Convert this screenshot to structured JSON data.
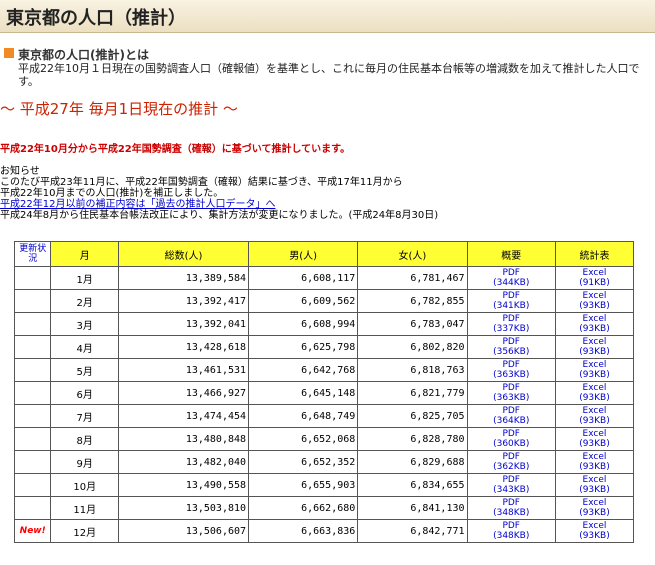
{
  "header": {
    "title": "東京都の人口（推計）"
  },
  "definition": {
    "title": "東京都の人口(推計)とは",
    "body": "平成22年10月１日現在の国勢調査人口（確報値）を基準とし、これに毎月の住民基本台帳等の増減数を加えて推計した人口です。"
  },
  "estimate_heading": "～ 平成27年 毎月1日現在の推計 ～",
  "red_note": "平成22年10月分から平成22年国勢調査（確報）に基づいて推計しています。",
  "notice": {
    "title": "お知らせ",
    "line1": "このたび平成23年11月に、平成22年国勢調査（確報）結果に基づき、平成17年11月から",
    "line2": "平成22年10月までの人口(推計)を補正しました。",
    "line3": "平成22年12月以前の補正内容は「過去の推計人口データ」へ",
    "line4": "平成24年8月から住民基本台帳法改正により、集計方法が変更になりました。(平成24年8月30日)"
  },
  "table": {
    "headers": {
      "update": "更新状況",
      "month": "月",
      "total": "総数(人)",
      "male": "男(人)",
      "female": "女(人)",
      "summary": "概要",
      "stats": "統計表"
    },
    "rows": [
      {
        "new": "",
        "month": "1月",
        "total": "13,389,584",
        "male": "6,608,117",
        "female": "6,781,467",
        "pdf": "PDF",
        "pdf_size": "(344KB)",
        "excel": "Excel",
        "excel_size": "(91KB)"
      },
      {
        "new": "",
        "month": "2月",
        "total": "13,392,417",
        "male": "6,609,562",
        "female": "6,782,855",
        "pdf": "PDF",
        "pdf_size": "(341KB)",
        "excel": "Excel",
        "excel_size": "(93KB)"
      },
      {
        "new": "",
        "month": "3月",
        "total": "13,392,041",
        "male": "6,608,994",
        "female": "6,783,047",
        "pdf": "PDF",
        "pdf_size": "(337KB)",
        "excel": "Excel",
        "excel_size": "(93KB)"
      },
      {
        "new": "",
        "month": "4月",
        "total": "13,428,618",
        "male": "6,625,798",
        "female": "6,802,820",
        "pdf": "PDF",
        "pdf_size": "(356KB)",
        "excel": "Excel",
        "excel_size": "(93KB)"
      },
      {
        "new": "",
        "month": "5月",
        "total": "13,461,531",
        "male": "6,642,768",
        "female": "6,818,763",
        "pdf": "PDF",
        "pdf_size": "(363KB)",
        "excel": "Excel",
        "excel_size": "(93KB)"
      },
      {
        "new": "",
        "month": "6月",
        "total": "13,466,927",
        "male": "6,645,148",
        "female": "6,821,779",
        "pdf": "PDF",
        "pdf_size": "(363KB)",
        "excel": "Excel",
        "excel_size": "(93KB)"
      },
      {
        "new": "",
        "month": "7月",
        "total": "13,474,454",
        "male": "6,648,749",
        "female": "6,825,705",
        "pdf": "PDF",
        "pdf_size": "(364KB)",
        "excel": "Excel",
        "excel_size": "(93KB)"
      },
      {
        "new": "",
        "month": "8月",
        "total": "13,480,848",
        "male": "6,652,068",
        "female": "6,828,780",
        "pdf": "PDF",
        "pdf_size": "(360KB)",
        "excel": "Excel",
        "excel_size": "(93KB)"
      },
      {
        "new": "",
        "month": "9月",
        "total": "13,482,040",
        "male": "6,652,352",
        "female": "6,829,688",
        "pdf": "PDF",
        "pdf_size": "(362KB)",
        "excel": "Excel",
        "excel_size": "(93KB)"
      },
      {
        "new": "",
        "month": "10月",
        "total": "13,490,558",
        "male": "6,655,903",
        "female": "6,834,655",
        "pdf": "PDF",
        "pdf_size": "(343KB)",
        "excel": "Excel",
        "excel_size": "(93KB)"
      },
      {
        "new": "",
        "month": "11月",
        "total": "13,503,810",
        "male": "6,662,680",
        "female": "6,841,130",
        "pdf": "PDF",
        "pdf_size": "(348KB)",
        "excel": "Excel",
        "excel_size": "(93KB)"
      },
      {
        "new": "New!",
        "month": "12月",
        "total": "13,506,607",
        "male": "6,663,836",
        "female": "6,842,771",
        "pdf": "PDF",
        "pdf_size": "(348KB)",
        "excel": "Excel",
        "excel_size": "(93KB)"
      }
    ]
  }
}
